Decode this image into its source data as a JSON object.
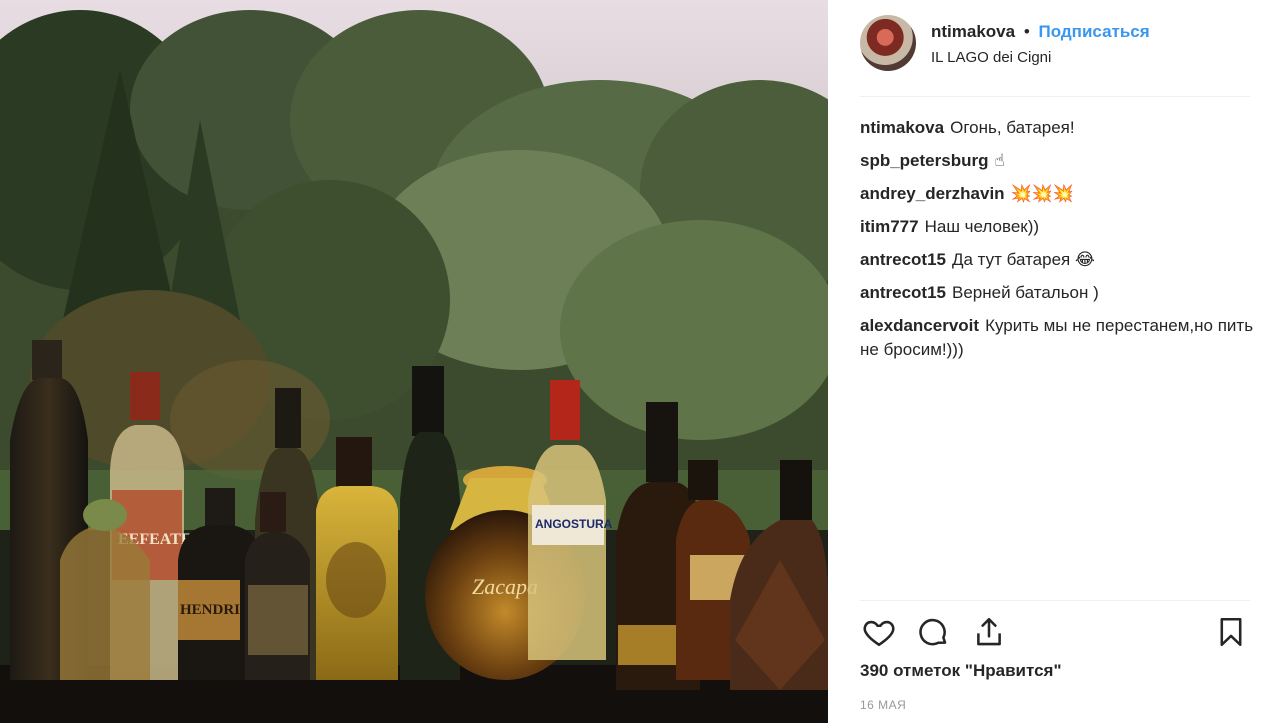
{
  "post": {
    "username": "ntimakova",
    "separator": "•",
    "follow_label": "Подписаться",
    "location": "IL LAGO dei Cigni"
  },
  "comments": [
    {
      "author": "ntimakova",
      "text": "Огонь, батарея!"
    },
    {
      "author": "spb_petersburg",
      "text": "☝"
    },
    {
      "author": "andrey_derzhavin",
      "text": "💥💥💥"
    },
    {
      "author": "itim777",
      "text": "Наш человек))"
    },
    {
      "author": "antrecot15",
      "text": "Да тут батарея 😂"
    },
    {
      "author": "antrecot15",
      "text": "Верней батальон )"
    },
    {
      "author": "alexdancervoit",
      "text": "Курить мы не перестанем,но пить не бросим!)))"
    }
  ],
  "actions": {
    "icons": [
      "heart-icon",
      "comment-icon",
      "share-icon",
      "bookmark-icon"
    ]
  },
  "likes": "390 отметок \"Нравится\"",
  "date": "16 МАЯ",
  "photo": {
    "label_angostura": "ANGOSTURA",
    "label_beefeater": "EEFEATER",
    "label_hendricks": "HENDRI",
    "label_brand": "Zacapa"
  },
  "colors": {
    "link": "#3897f0",
    "text": "#262626",
    "muted": "#999999",
    "divider": "#efefef"
  }
}
